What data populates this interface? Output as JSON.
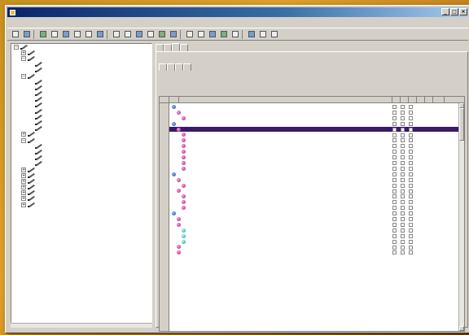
{
  "window": {
    "title": "",
    "min": "_",
    "max": "□",
    "close": "×"
  },
  "menubar": [],
  "toolbar": {
    "icons": [
      "back-icon",
      "forward-icon",
      "print-icon",
      "preview-icon",
      "copy-icon",
      "paste-icon",
      "cut-icon",
      "find-icon",
      "grid1-icon",
      "grid2-icon",
      "grid3-icon",
      "grid4-icon",
      "grid5-icon",
      "grid6-icon",
      "grid7-icon",
      "grid8-icon",
      "grid9-icon",
      "grid10-icon",
      "grid11-icon",
      "grid12-icon",
      "grid13-icon",
      "grid14-icon"
    ]
  },
  "tree": {
    "items": [
      {
        "level": 0,
        "exp": "−",
        "label": "",
        "sel": false
      },
      {
        "level": 1,
        "exp": "+",
        "label": "",
        "sel": false
      },
      {
        "level": 1,
        "exp": "−",
        "label": "",
        "sel": false
      },
      {
        "level": 2,
        "exp": "",
        "label": "",
        "sel": false
      },
      {
        "level": 2,
        "exp": "",
        "label": "",
        "sel": true
      },
      {
        "level": 1,
        "exp": "−",
        "label": "",
        "sel": false
      },
      {
        "level": 2,
        "exp": "",
        "label": "",
        "sel": false
      },
      {
        "level": 2,
        "exp": "",
        "label": "",
        "sel": false
      },
      {
        "level": 2,
        "exp": "",
        "label": "",
        "sel": false
      },
      {
        "level": 2,
        "exp": "",
        "label": "",
        "sel": false
      },
      {
        "level": 2,
        "exp": "",
        "label": "",
        "sel": false
      },
      {
        "level": 2,
        "exp": "",
        "label": "",
        "sel": false
      },
      {
        "level": 2,
        "exp": "",
        "label": "",
        "sel": false
      },
      {
        "level": 2,
        "exp": "",
        "label": "",
        "sel": false
      },
      {
        "level": 2,
        "exp": "",
        "label": "",
        "sel": false
      },
      {
        "level": 1,
        "exp": "+",
        "label": "",
        "sel": false
      },
      {
        "level": 1,
        "exp": "−",
        "label": "",
        "sel": false
      },
      {
        "level": 2,
        "exp": "",
        "label": "",
        "sel": false
      },
      {
        "level": 2,
        "exp": "",
        "label": "",
        "sel": false
      },
      {
        "level": 2,
        "exp": "",
        "label": "",
        "sel": false
      },
      {
        "level": 2,
        "exp": "",
        "label": "",
        "sel": false
      },
      {
        "level": 1,
        "exp": "+",
        "label": "",
        "sel": false
      },
      {
        "level": 1,
        "exp": "+",
        "label": "",
        "sel": false
      },
      {
        "level": 1,
        "exp": "+",
        "label": "",
        "sel": false
      },
      {
        "level": 1,
        "exp": "+",
        "label": "",
        "sel": false
      },
      {
        "level": 1,
        "exp": "+",
        "label": "",
        "sel": false
      },
      {
        "level": 1,
        "exp": "+",
        "label": "",
        "sel": false
      },
      {
        "level": 1,
        "exp": "+",
        "label": "",
        "sel": false
      }
    ]
  },
  "tabs_main": [
    {
      "label": "",
      "active": false
    },
    {
      "label": "",
      "active": false
    },
    {
      "label": "",
      "active": true
    },
    {
      "label": "",
      "active": false
    }
  ],
  "tabs_sub": [
    {
      "label": "",
      "active": true
    },
    {
      "label": "",
      "active": false
    },
    {
      "label": "",
      "active": false
    },
    {
      "label": "",
      "active": false
    }
  ],
  "grid": {
    "headers": [
      "",
      "",
      "",
      "",
      "",
      "",
      "",
      "",
      ""
    ],
    "rows": [
      {
        "indent": 0,
        "bullet": "b-blue",
        "text": "",
        "hl": false
      },
      {
        "indent": 1,
        "bullet": "b-mag",
        "text": "",
        "hl": false
      },
      {
        "indent": 2,
        "bullet": "b-mag",
        "text": "",
        "hl": false
      },
      {
        "indent": 0,
        "bullet": "b-blue",
        "text": "",
        "hl": false
      },
      {
        "indent": 1,
        "bullet": "b-mag",
        "text": "",
        "hl": true
      },
      {
        "indent": 2,
        "bullet": "b-mag",
        "text": "",
        "hl": false
      },
      {
        "indent": 2,
        "bullet": "b-mag",
        "text": "",
        "hl": false
      },
      {
        "indent": 2,
        "bullet": "b-mag",
        "text": "",
        "hl": false
      },
      {
        "indent": 2,
        "bullet": "b-mag",
        "text": "",
        "hl": false
      },
      {
        "indent": 2,
        "bullet": "b-mag",
        "text": "",
        "hl": false
      },
      {
        "indent": 2,
        "bullet": "b-mag",
        "text": "",
        "hl": false
      },
      {
        "indent": 2,
        "bullet": "b-mag",
        "text": "",
        "hl": false
      },
      {
        "indent": 0,
        "bullet": "b-blue",
        "text": "",
        "hl": false
      },
      {
        "indent": 1,
        "bullet": "b-mag",
        "text": "",
        "hl": false
      },
      {
        "indent": 2,
        "bullet": "b-mag",
        "text": "",
        "hl": false
      },
      {
        "indent": 1,
        "bullet": "b-mag",
        "text": "",
        "hl": false
      },
      {
        "indent": 2,
        "bullet": "b-mag",
        "text": "",
        "hl": false
      },
      {
        "indent": 2,
        "bullet": "b-mag",
        "text": "",
        "hl": false
      },
      {
        "indent": 2,
        "bullet": "b-mag",
        "text": "",
        "hl": false
      },
      {
        "indent": 0,
        "bullet": "b-blue",
        "text": "",
        "hl": false
      },
      {
        "indent": 1,
        "bullet": "b-mag",
        "text": "",
        "hl": false
      },
      {
        "indent": 1,
        "bullet": "b-mag",
        "text": "",
        "hl": false
      },
      {
        "indent": 2,
        "bullet": "b-teal",
        "text": "",
        "hl": false
      },
      {
        "indent": 2,
        "bullet": "b-teal",
        "text": "",
        "hl": false
      },
      {
        "indent": 2,
        "bullet": "b-teal",
        "text": "",
        "hl": false
      },
      {
        "indent": 1,
        "bullet": "b-mag",
        "text": "",
        "hl": false
      },
      {
        "indent": 1,
        "bullet": "b-mag",
        "text": "",
        "hl": false
      }
    ],
    "check_values": [
      "",
      "",
      ""
    ]
  },
  "status": {
    "text": ""
  }
}
